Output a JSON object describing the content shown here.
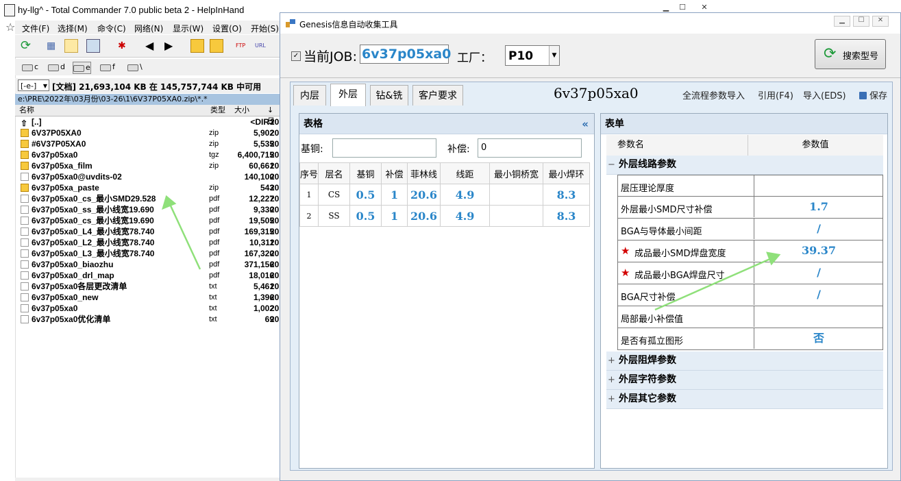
{
  "tc": {
    "title": "hy-llg^ - Total Commander 7.0 public beta 2 - HelpInHand",
    "menu": [
      "文件(F)",
      "选择(M)",
      "命令(C)",
      "网络(N)",
      "显示(W)",
      "设置(O)",
      "开始(S)"
    ],
    "drives": [
      "c",
      "d",
      "e",
      "f",
      "\\"
    ],
    "drive_select": "[-e-]",
    "free_space": "[文档]  21,693,104 KB 在 145,757,744 KB 中可用",
    "path": "e:\\PRE\\2022年\\03月份\\03-26\\1\\6V37P05XA0.zip\\*.*",
    "columns": {
      "name": "名称",
      "type": "类型",
      "size": "大小",
      "date": "↓日"
    },
    "files": [
      {
        "name": "[..]",
        "type": "",
        "size": "<DIR>",
        "date": "20",
        "icon": "up"
      },
      {
        "name": "6V37P05XA0",
        "type": "zip",
        "size": "5,902",
        "date": "20",
        "icon": "zip"
      },
      {
        "name": "#6V37P05XA0",
        "type": "zip",
        "size": "5,535",
        "date": "20",
        "icon": "zip"
      },
      {
        "name": "6v37p05xa0",
        "type": "tgz",
        "size": "6,400,715",
        "date": "20",
        "icon": "zip"
      },
      {
        "name": "6v37p05xa_film",
        "type": "zip",
        "size": "60,661",
        "date": "20",
        "icon": "zip"
      },
      {
        "name": "6v37p05xa0@uvdits-02",
        "type": "",
        "size": "140,100",
        "date": "20",
        "icon": "pdf"
      },
      {
        "name": "6v37p05xa_paste",
        "type": "zip",
        "size": "543",
        "date": "20",
        "icon": "zip"
      },
      {
        "name": "6v37p05xa0_cs_最小SMD29.528",
        "type": "pdf",
        "size": "12,227",
        "date": "20",
        "icon": "pdf"
      },
      {
        "name": "6v37p05xa0_ss_最小线宽19.690",
        "type": "pdf",
        "size": "9,330",
        "date": "20",
        "icon": "pdf"
      },
      {
        "name": "6v37p05xa0_cs_最小线宽19.690",
        "type": "pdf",
        "size": "19,505",
        "date": "20",
        "icon": "pdf"
      },
      {
        "name": "6v37p05xa0_L4_最小线宽78.740",
        "type": "pdf",
        "size": "169,315",
        "date": "20",
        "icon": "pdf"
      },
      {
        "name": "6v37p05xa0_L2_最小线宽78.740",
        "type": "pdf",
        "size": "10,311",
        "date": "20",
        "icon": "pdf"
      },
      {
        "name": "6v37p05xa0_L3_最小线宽78.740",
        "type": "pdf",
        "size": "167,320",
        "date": "20",
        "icon": "pdf"
      },
      {
        "name": "6v37p05xa0_biaozhu",
        "type": "pdf",
        "size": "371,156",
        "date": "20",
        "icon": "pdf"
      },
      {
        "name": "6v37p05xa0_drl_map",
        "type": "pdf",
        "size": "18,016",
        "date": "20",
        "icon": "pdf"
      },
      {
        "name": "6v37p05xa0各层更改清单",
        "type": "txt",
        "size": "5,461",
        "date": "20",
        "icon": "pdf"
      },
      {
        "name": "6v37p05xa0_new",
        "type": "txt",
        "size": "1,396",
        "date": "20",
        "icon": "pdf"
      },
      {
        "name": "6v37p05xa0",
        "type": "txt",
        "size": "1,002",
        "date": "20",
        "icon": "pdf"
      },
      {
        "name": "6v37p05xa0优化清单",
        "type": "txt",
        "size": "69",
        "date": "20",
        "icon": "pdf"
      }
    ]
  },
  "gw": {
    "title": "Genesis信息自动收集工具",
    "job_label": "当前JOB:",
    "job_value": "6v37p05xa0",
    "factory_label": "工厂：",
    "factory_value": "P10",
    "search_label": "搜索型号",
    "tabs": [
      "内层",
      "外层",
      "钻&铣",
      "客户要求"
    ],
    "active_tab": 1,
    "job_display": "6v37p05xa0",
    "links": {
      "import_all": "全流程参数导入",
      "reference": "引用(F4)",
      "import_eds": "导入(EDS)",
      "save": "保存"
    },
    "table_panel": {
      "title": "表格",
      "base_copper_label": "基铜:",
      "base_copper_value": "",
      "compensation_label": "补偿:",
      "compensation_value": "0",
      "columns": [
        "序号",
        "层名",
        "基铜",
        "补偿",
        "菲林线",
        "线距",
        "最小铜桥宽",
        "最小焊环"
      ],
      "rows": [
        [
          "1",
          "CS",
          "0.5",
          "1",
          "20.6",
          "4.9",
          "",
          "8.3"
        ],
        [
          "2",
          "SS",
          "0.5",
          "1",
          "20.6",
          "4.9",
          "",
          "8.3"
        ]
      ]
    },
    "form_panel": {
      "title": "表单",
      "col_name": "参数名",
      "col_value": "参数值",
      "groups": [
        {
          "title": "外层线路参数",
          "expanded": true,
          "toggle": "−"
        },
        {
          "title": "外层阻焊参数",
          "expanded": false,
          "toggle": "+"
        },
        {
          "title": "外层字符参数",
          "expanded": false,
          "toggle": "+"
        },
        {
          "title": "外层其它参数",
          "expanded": false,
          "toggle": "+"
        }
      ],
      "params": [
        {
          "name": "层压理论厚度",
          "value": "",
          "star": false
        },
        {
          "name": "外层最小SMD尺寸补偿",
          "value": "1.7",
          "star": false
        },
        {
          "name": "BGA与导体最小间距",
          "value": "/",
          "star": false
        },
        {
          "name": "成品最小SMD焊盘宽度",
          "value": "39.37",
          "star": true
        },
        {
          "name": "成品最小BGA焊盘尺寸",
          "value": "/",
          "star": true
        },
        {
          "name": "BGA尺寸补偿",
          "value": "/",
          "star": false
        },
        {
          "name": "局部最小补偿值",
          "value": "",
          "star": false
        },
        {
          "name": "是否有孤立图形",
          "value": "否",
          "star": false
        }
      ]
    }
  },
  "colors": {
    "accent_blue": "#2a86c9",
    "arrow_green": "#8fe07a",
    "star_red": "#d20000"
  }
}
